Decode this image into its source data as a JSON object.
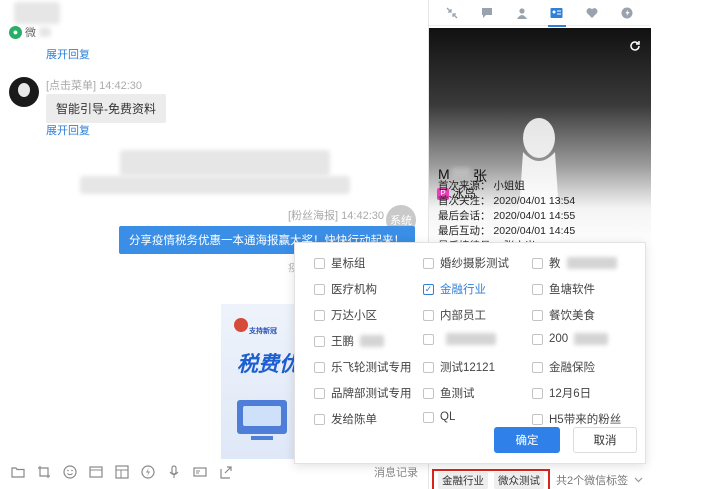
{
  "chat": {
    "wechat_label": "微",
    "expand_reply_1": "展开回复",
    "msg1": {
      "meta": "[点击菜单] 14:42:30",
      "text": "智能引导-免费资料",
      "expand": "展开回复"
    },
    "msg2": {
      "meta": "[粉丝海报] 14:42:30",
      "avatar": "系统",
      "text": "分享疫情税务优惠一本通海报赢大奖！快快行动起来！",
      "stray": "疫"
    },
    "poster": {
      "line1": "支持新冠",
      "title": "税费优"
    },
    "message_record": "消息记录"
  },
  "panel": {
    "tabs": [
      "shrink-icon",
      "comment-icon",
      "user-icon",
      "id-card-icon",
      "heart-icon",
      "chart-icon"
    ],
    "active_tab": 3,
    "name_prefix": "M",
    "name_suffix": "张",
    "nickname": "冰岛",
    "info": [
      "首次来源： 小姐姐",
      "首次关注： 2020/04/01 13:54",
      "最后会话： 2020/04/01 14:55",
      "最后互动： 2020/04/01 14:45",
      "最后接待员： 张小米"
    ]
  },
  "tag_bar": {
    "tags": [
      "金融行业",
      "微众测试"
    ],
    "count_text": "共2个微信标签"
  },
  "popup": {
    "options": [
      {
        "label": "星标组",
        "checked": false
      },
      {
        "label": "婚纱摄影测试",
        "checked": false
      },
      {
        "label": "教",
        "checked": false
      },
      {
        "label": "医疗机构",
        "checked": false
      },
      {
        "label": "金融行业",
        "checked": true
      },
      {
        "label": "鱼塘软件",
        "checked": false
      },
      {
        "label": "万达小区",
        "checked": false
      },
      {
        "label": "内部员工",
        "checked": false
      },
      {
        "label": "餐饮美食",
        "checked": false
      },
      {
        "label": "王鹏",
        "checked": false
      },
      {
        "label": "",
        "checked": false
      },
      {
        "label": "200",
        "checked": false
      },
      {
        "label": "乐飞轮测试专用",
        "checked": false
      },
      {
        "label": "测试12121",
        "checked": false
      },
      {
        "label": "金融保险",
        "checked": false
      },
      {
        "label": "品牌部测试专用",
        "checked": false
      },
      {
        "label": "鱼测试",
        "checked": false
      },
      {
        "label": "12月6日",
        "checked": false
      },
      {
        "label": "发给陈单",
        "checked": false
      },
      {
        "label": "QL",
        "checked": false
      },
      {
        "label": "H5带来的粉丝",
        "checked": false
      }
    ],
    "ok_label": "确定",
    "cancel_label": "取消"
  },
  "toolbar": {
    "icons": [
      "folder-icon",
      "crop-icon",
      "emoji-icon",
      "file-icon",
      "template-icon",
      "flash-icon",
      "microphone-icon",
      "card-icon",
      "export-icon"
    ]
  }
}
